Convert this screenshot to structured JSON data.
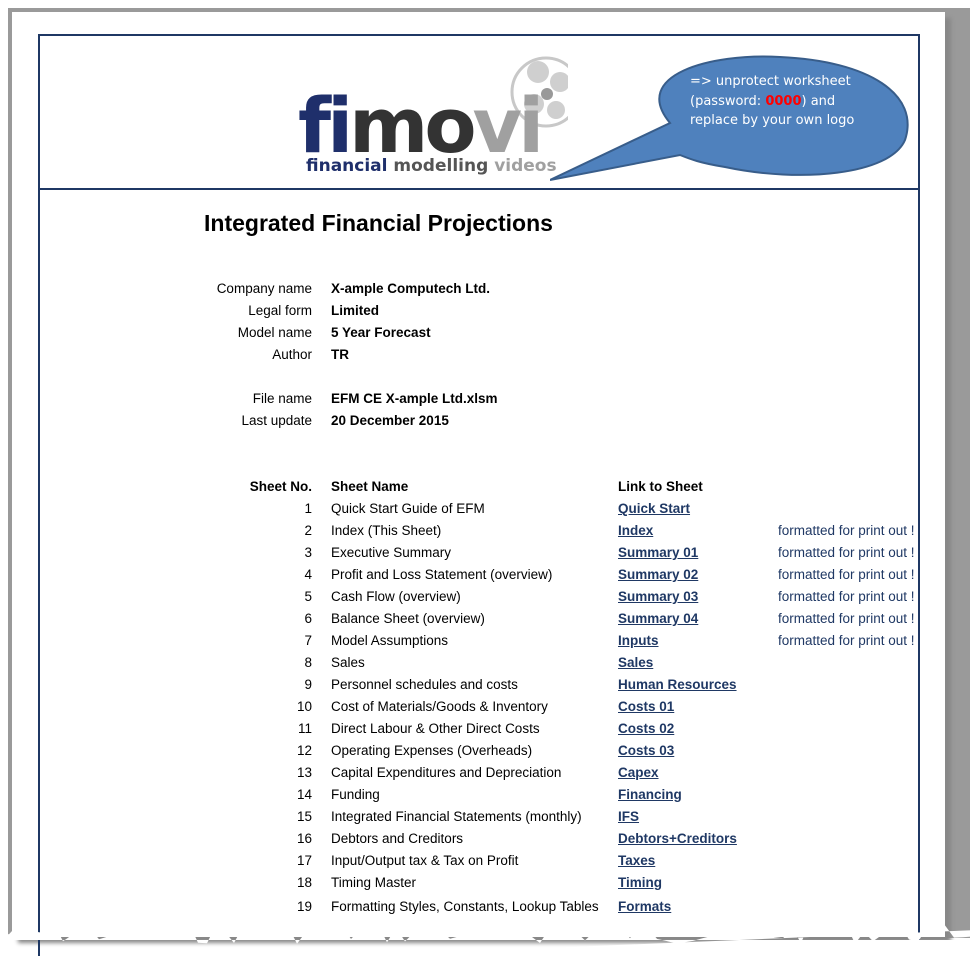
{
  "logo": {
    "brand": "fimovi",
    "tagline_part1": "financial",
    "tagline_part2": "modelling",
    "tagline_part3": "videos"
  },
  "callout": {
    "line1": "=> unprotect worksheet",
    "line2_pre": "(password: ",
    "password": "0000",
    "line2_post": ") and",
    "line3": "replace by your own logo",
    "color": "#4f81bd"
  },
  "title": "Integrated Financial Projections",
  "info": [
    {
      "label": "Company name",
      "value": "X-ample Computech Ltd."
    },
    {
      "label": "Legal form",
      "value": "Limited"
    },
    {
      "label": "Model name",
      "value": "5 Year Forecast"
    },
    {
      "label": "Author",
      "value": "TR"
    },
    {
      "label": "File name",
      "value": "EFM CE X-ample Ltd.xlsm"
    },
    {
      "label": "Last update",
      "value": "20 December 2015"
    }
  ],
  "table": {
    "headers": {
      "no": "Sheet No.",
      "name": "Sheet Name",
      "link": "Link to Sheet"
    },
    "rows": [
      {
        "no": "1",
        "name": "Quick Start Guide of EFM",
        "link": "Quick Start",
        "note": ""
      },
      {
        "no": "2",
        "name": "Index (This Sheet)",
        "link": "Index",
        "note": "formatted for print out !"
      },
      {
        "no": "3",
        "name": "Executive Summary",
        "link": "Summary 01",
        "note": "formatted for print out !"
      },
      {
        "no": "4",
        "name": "Profit and Loss Statement (overview)",
        "link": "Summary 02",
        "note": "formatted for print out !"
      },
      {
        "no": "5",
        "name": "Cash Flow (overview)",
        "link": "Summary 03",
        "note": "formatted for print out !"
      },
      {
        "no": "6",
        "name": "Balance Sheet (overview)",
        "link": "Summary 04",
        "note": "formatted for print out !"
      },
      {
        "no": "7",
        "name": "Model Assumptions",
        "link": "Inputs",
        "note": "formatted for print out !"
      },
      {
        "no": "8",
        "name": "Sales",
        "link": "Sales",
        "note": ""
      },
      {
        "no": "9",
        "name": "Personnel schedules and costs",
        "link": "Human Resources",
        "note": ""
      },
      {
        "no": "10",
        "name": "Cost of Materials/Goods & Inventory",
        "link": "Costs 01",
        "note": ""
      },
      {
        "no": "11",
        "name": "Direct Labour & Other Direct Costs",
        "link": "Costs 02",
        "note": ""
      },
      {
        "no": "12",
        "name": "Operating Expenses (Overheads)",
        "link": "Costs 03",
        "note": ""
      },
      {
        "no": "13",
        "name": "Capital Expenditures and Depreciation",
        "link": "Capex",
        "note": ""
      },
      {
        "no": "14",
        "name": "Funding",
        "link": "Financing",
        "note": ""
      },
      {
        "no": "15",
        "name": "Integrated Financial Statements (monthly)",
        "link": "IFS",
        "note": ""
      },
      {
        "no": "16",
        "name": "Debtors and Creditors",
        "link": "Debtors+Creditors",
        "note": ""
      },
      {
        "no": "17",
        "name": "Input/Output tax & Tax on Profit",
        "link": "Taxes",
        "note": ""
      },
      {
        "no": "18",
        "name": "Timing Master",
        "link": "Timing",
        "note": ""
      },
      {
        "no": "19",
        "name": "Formatting Styles, Constants, Lookup Tables",
        "link": "Formats",
        "note": ""
      }
    ]
  }
}
